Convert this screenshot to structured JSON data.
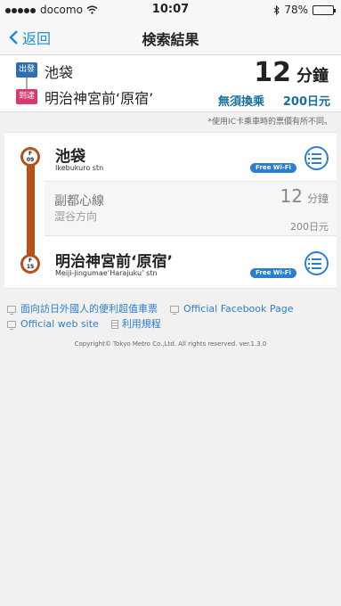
{
  "status_bar": {
    "carrier": "docomo",
    "time": "10:07",
    "battery": "78%",
    "battery_level": 0.78
  },
  "nav": {
    "back_label": "返回",
    "title": "検索結果"
  },
  "summary": {
    "departure_badge": "出發",
    "arrival_badge": "到達",
    "departure": "池袋",
    "arrival": "明治神宮前‘原宿’",
    "time_value": "12",
    "time_unit": "分鐘",
    "transfer": "無須換乘",
    "fare": "200日元"
  },
  "ic_note": "*使用IC卡乘車時的票價有所不同。",
  "route": {
    "line_color": "#b5521c",
    "from": {
      "code_letter": "F",
      "code_num": "09",
      "name": "池袋",
      "roman": "Ikebukuro stn",
      "wifi": "Free Wi-Fi"
    },
    "segment": {
      "line": "副都心線",
      "direction": "澀谷方向",
      "time_value": "12",
      "time_unit": "分鐘",
      "fare": "200日元"
    },
    "to": {
      "code_letter": "F",
      "code_num": "15",
      "name": "明治神宮前‘原宿’",
      "roman": "Meiji-jingumae‘Harajuku’ stn",
      "wifi": "Free Wi-Fi"
    }
  },
  "links": {
    "foreign_pass": "面向訪日外國人的便利超值車票",
    "facebook": "Official Facebook Page",
    "website": "Official web site",
    "terms": "利用規程"
  },
  "copyright": "Copyright© Tokyo Metro Co.,Ltd. All rights reserved. ver.1.3.0"
}
